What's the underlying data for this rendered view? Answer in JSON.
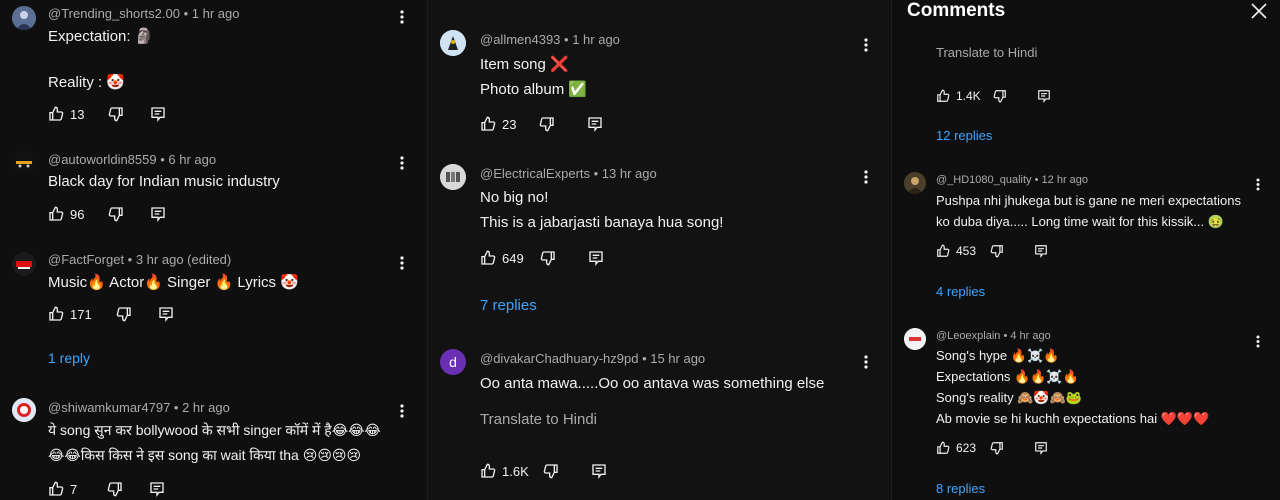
{
  "col1": [
    {
      "handle": "@Trending_shorts2.00",
      "time": "1 hr ago",
      "lines": [
        "Expectation: 🗿",
        "",
        "Reality : 🤡"
      ],
      "likes": "13",
      "replies": ""
    },
    {
      "handle": "@autoworldin8559",
      "time": "6 hr ago",
      "lines": [
        "Black day for Indian music industry"
      ],
      "likes": "96",
      "replies": ""
    },
    {
      "handle": "@FactForget",
      "time": "3 hr ago (edited)",
      "lines": [
        "Music🔥 Actor🔥 Singer 🔥 Lyrics 🤡"
      ],
      "likes": "171",
      "replies": "1 reply"
    },
    {
      "handle": "@shiwamkumar4797",
      "time": "2 hr ago",
      "lines": [
        "ये  song सुन कर bollywood के सभी singer कॉमें में है😂😂😂",
        "😂😂किस किस ने इस song का wait किया tha 😢😢😢😢"
      ],
      "likes": "7",
      "replies": ""
    }
  ],
  "col2": [
    {
      "handle": "@allmen4393",
      "time": "1 hr ago",
      "lines": [
        "Item song ❌",
        "Photo album ✅"
      ],
      "likes": "23",
      "replies": ""
    },
    {
      "handle": "@ElectricalExperts",
      "time": "13 hr ago",
      "lines": [
        "No big no!",
        "This is a jabarjasti banaya hua song!"
      ],
      "likes": "649",
      "replies": "7 replies"
    },
    {
      "handle": "@divakarChadhuary-hz9pd",
      "time": "15 hr ago",
      "avatar_letter": "d",
      "lines": [
        "Oo anta mawa.....Oo oo antava was something else"
      ],
      "translate": "Translate to Hindi",
      "likes": "1.6K",
      "replies": ""
    }
  ],
  "col3": {
    "title": "Comments",
    "top": {
      "translate": "Translate to Hindi",
      "likes": "1.4K",
      "replies": "12 replies"
    },
    "comments": [
      {
        "handle": "@_HD1080_quality",
        "time": "12 hr ago",
        "lines": [
          "Pushpa nhi jhukega but is gane ne meri expectations",
          "ko duba diya..... Long time wait for this kissik... 🤢"
        ],
        "likes": "453",
        "replies": "4 replies"
      },
      {
        "handle": "@Leoexplain",
        "time": "4 hr ago",
        "lines": [
          "Song's hype 🔥☠️🔥",
          "Expectations 🔥🔥☠️🔥",
          "Song's reality 🙈🤡🙈🐸",
          "Ab movie se hi kuchh expectations hai ❤️❤️❤️"
        ],
        "likes": "623",
        "replies": "8 replies"
      }
    ]
  },
  "icons": [
    "like-icon",
    "dislike-icon",
    "reply-icon",
    "more-vert-icon",
    "close-icon"
  ],
  "colors": {
    "background": "#0f0f0f",
    "text": "#f1f1f1",
    "meta": "#aaaaaa",
    "link": "#3ea6ff",
    "avatar_d": "#6b2fb3"
  }
}
